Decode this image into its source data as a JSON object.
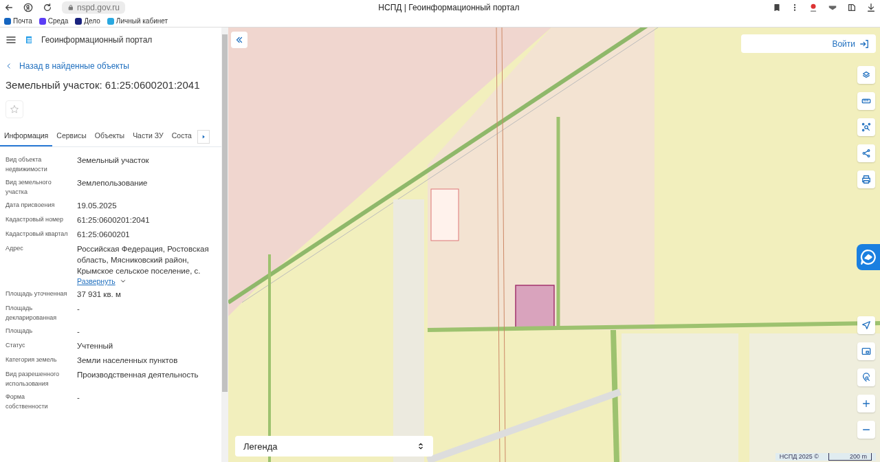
{
  "browser": {
    "address": "nspd.gov.ru",
    "title": "НСПД | Геоинформационный портал",
    "bookmarks": [
      {
        "label": "Почта",
        "color": "#1565c0"
      },
      {
        "label": "Среда",
        "color": "#5b3df5"
      },
      {
        "label": "Дело",
        "color": "#1a237e"
      },
      {
        "label": "Личный кабинет",
        "color": "#29a8e0"
      }
    ]
  },
  "header": {
    "title": "Геоинформационный портал"
  },
  "back_link": "Назад в найденные объекты",
  "object_title": "Земельный участок: 61:25:0600201:2041",
  "favorite": {
    "selected": false
  },
  "tabs": [
    {
      "label": "Информация",
      "selected": true
    },
    {
      "label": "Сервисы",
      "selected": false
    },
    {
      "label": "Объекты",
      "selected": false
    },
    {
      "label": "Части ЗУ",
      "selected": false
    },
    {
      "label": "Соста",
      "selected": false
    }
  ],
  "fields": [
    {
      "label": "Вид объекта недвижимости",
      "value": "Земельный участок"
    },
    {
      "label": "Вид земельного участка",
      "value": "Землепользование"
    },
    {
      "label": "Дата присвоения",
      "value": "19.05.2025"
    },
    {
      "label": "Кадастровый номер",
      "value": "61:25:0600201:2041"
    },
    {
      "label": "Кадастровый квартал",
      "value": "61:25:0600201"
    },
    {
      "label": "Адрес",
      "value": "Российская Федерация, Ростовская область, Мясниковский район, Крымское сельское поселение, с.",
      "expand": "Развернуть"
    },
    {
      "label": "Площадь уточненная",
      "value": "37 931 кв. м"
    },
    {
      "label": "Площадь декларированная",
      "value": "-"
    },
    {
      "label": "Площадь",
      "value": "-"
    },
    {
      "label": "Статус",
      "value": "Учтенный"
    },
    {
      "label": "Категория земель",
      "value": "Земли населенных пунктов"
    },
    {
      "label": "Вид разрешенного использования",
      "value": "Производственная деятельность"
    },
    {
      "label": "Форма собственности",
      "value": "-"
    }
  ],
  "map": {
    "login": "Войти",
    "legend": "Легенда",
    "attribution": "НСПД 2025 ©",
    "scale": "200 m"
  }
}
